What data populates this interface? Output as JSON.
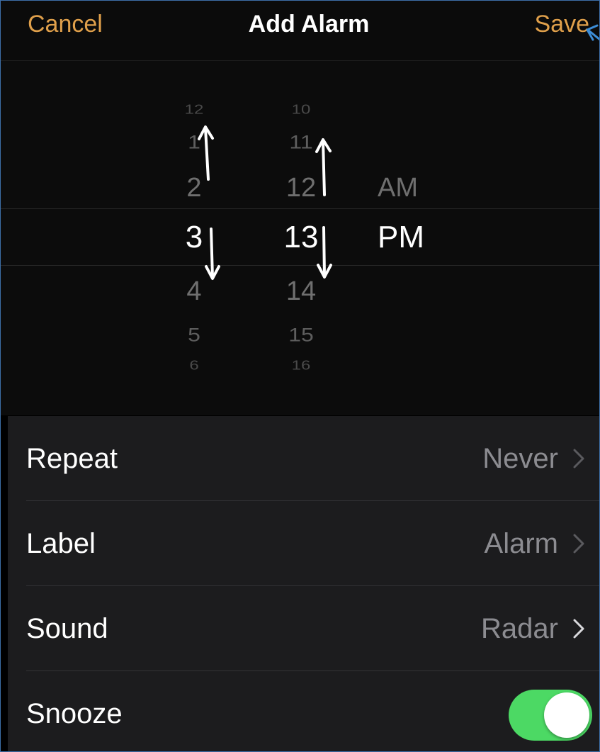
{
  "navbar": {
    "cancel_label": "Cancel",
    "title": "Add Alarm",
    "save_label": "Save",
    "accent_color": "#e0a04b"
  },
  "picker": {
    "hours": [
      "12",
      "1",
      "2",
      "3",
      "4",
      "5",
      "6"
    ],
    "minutes": [
      "10",
      "11",
      "12",
      "13",
      "14",
      "15",
      "16"
    ],
    "periods": [
      "AM",
      "PM"
    ],
    "selected": {
      "hour": "3",
      "minute": "13",
      "period": "PM"
    }
  },
  "settings": [
    {
      "label": "Repeat",
      "value": "Never",
      "icon": "chevron-right-icon"
    },
    {
      "label": "Label",
      "value": "Alarm",
      "icon": "chevron-right-icon"
    },
    {
      "label": "Sound",
      "value": "Radar",
      "icon": "chevron-right-icon"
    },
    {
      "label": "Snooze",
      "toggle_on": true,
      "toggle_color": "#4cd964"
    }
  ],
  "annotations": {
    "arrows": [
      "arrow-up-icon",
      "arrow-up-icon",
      "arrow-down-icon",
      "arrow-down-icon",
      "arrow-pointer-icon"
    ]
  }
}
